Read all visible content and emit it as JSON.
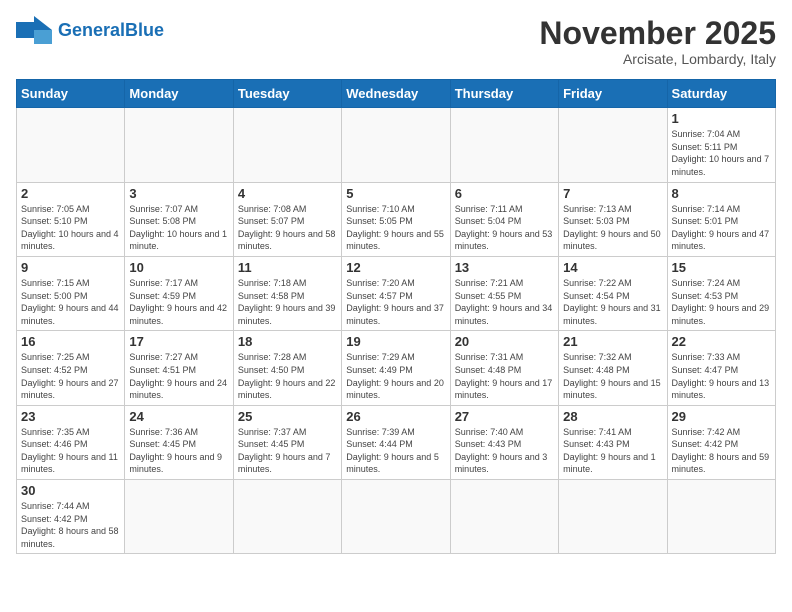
{
  "logo": {
    "text_general": "General",
    "text_blue": "Blue"
  },
  "header": {
    "month": "November 2025",
    "location": "Arcisate, Lombardy, Italy"
  },
  "days_of_week": [
    "Sunday",
    "Monday",
    "Tuesday",
    "Wednesday",
    "Thursday",
    "Friday",
    "Saturday"
  ],
  "weeks": [
    [
      {
        "day": "",
        "info": ""
      },
      {
        "day": "",
        "info": ""
      },
      {
        "day": "",
        "info": ""
      },
      {
        "day": "",
        "info": ""
      },
      {
        "day": "",
        "info": ""
      },
      {
        "day": "",
        "info": ""
      },
      {
        "day": "1",
        "info": "Sunrise: 7:04 AM\nSunset: 5:11 PM\nDaylight: 10 hours and 7 minutes."
      }
    ],
    [
      {
        "day": "2",
        "info": "Sunrise: 7:05 AM\nSunset: 5:10 PM\nDaylight: 10 hours and 4 minutes."
      },
      {
        "day": "3",
        "info": "Sunrise: 7:07 AM\nSunset: 5:08 PM\nDaylight: 10 hours and 1 minute."
      },
      {
        "day": "4",
        "info": "Sunrise: 7:08 AM\nSunset: 5:07 PM\nDaylight: 9 hours and 58 minutes."
      },
      {
        "day": "5",
        "info": "Sunrise: 7:10 AM\nSunset: 5:05 PM\nDaylight: 9 hours and 55 minutes."
      },
      {
        "day": "6",
        "info": "Sunrise: 7:11 AM\nSunset: 5:04 PM\nDaylight: 9 hours and 53 minutes."
      },
      {
        "day": "7",
        "info": "Sunrise: 7:13 AM\nSunset: 5:03 PM\nDaylight: 9 hours and 50 minutes."
      },
      {
        "day": "8",
        "info": "Sunrise: 7:14 AM\nSunset: 5:01 PM\nDaylight: 9 hours and 47 minutes."
      }
    ],
    [
      {
        "day": "9",
        "info": "Sunrise: 7:15 AM\nSunset: 5:00 PM\nDaylight: 9 hours and 44 minutes."
      },
      {
        "day": "10",
        "info": "Sunrise: 7:17 AM\nSunset: 4:59 PM\nDaylight: 9 hours and 42 minutes."
      },
      {
        "day": "11",
        "info": "Sunrise: 7:18 AM\nSunset: 4:58 PM\nDaylight: 9 hours and 39 minutes."
      },
      {
        "day": "12",
        "info": "Sunrise: 7:20 AM\nSunset: 4:57 PM\nDaylight: 9 hours and 37 minutes."
      },
      {
        "day": "13",
        "info": "Sunrise: 7:21 AM\nSunset: 4:55 PM\nDaylight: 9 hours and 34 minutes."
      },
      {
        "day": "14",
        "info": "Sunrise: 7:22 AM\nSunset: 4:54 PM\nDaylight: 9 hours and 31 minutes."
      },
      {
        "day": "15",
        "info": "Sunrise: 7:24 AM\nSunset: 4:53 PM\nDaylight: 9 hours and 29 minutes."
      }
    ],
    [
      {
        "day": "16",
        "info": "Sunrise: 7:25 AM\nSunset: 4:52 PM\nDaylight: 9 hours and 27 minutes."
      },
      {
        "day": "17",
        "info": "Sunrise: 7:27 AM\nSunset: 4:51 PM\nDaylight: 9 hours and 24 minutes."
      },
      {
        "day": "18",
        "info": "Sunrise: 7:28 AM\nSunset: 4:50 PM\nDaylight: 9 hours and 22 minutes."
      },
      {
        "day": "19",
        "info": "Sunrise: 7:29 AM\nSunset: 4:49 PM\nDaylight: 9 hours and 20 minutes."
      },
      {
        "day": "20",
        "info": "Sunrise: 7:31 AM\nSunset: 4:48 PM\nDaylight: 9 hours and 17 minutes."
      },
      {
        "day": "21",
        "info": "Sunrise: 7:32 AM\nSunset: 4:48 PM\nDaylight: 9 hours and 15 minutes."
      },
      {
        "day": "22",
        "info": "Sunrise: 7:33 AM\nSunset: 4:47 PM\nDaylight: 9 hours and 13 minutes."
      }
    ],
    [
      {
        "day": "23",
        "info": "Sunrise: 7:35 AM\nSunset: 4:46 PM\nDaylight: 9 hours and 11 minutes."
      },
      {
        "day": "24",
        "info": "Sunrise: 7:36 AM\nSunset: 4:45 PM\nDaylight: 9 hours and 9 minutes."
      },
      {
        "day": "25",
        "info": "Sunrise: 7:37 AM\nSunset: 4:45 PM\nDaylight: 9 hours and 7 minutes."
      },
      {
        "day": "26",
        "info": "Sunrise: 7:39 AM\nSunset: 4:44 PM\nDaylight: 9 hours and 5 minutes."
      },
      {
        "day": "27",
        "info": "Sunrise: 7:40 AM\nSunset: 4:43 PM\nDaylight: 9 hours and 3 minutes."
      },
      {
        "day": "28",
        "info": "Sunrise: 7:41 AM\nSunset: 4:43 PM\nDaylight: 9 hours and 1 minute."
      },
      {
        "day": "29",
        "info": "Sunrise: 7:42 AM\nSunset: 4:42 PM\nDaylight: 8 hours and 59 minutes."
      }
    ],
    [
      {
        "day": "30",
        "info": "Sunrise: 7:44 AM\nSunset: 4:42 PM\nDaylight: 8 hours and 58 minutes."
      },
      {
        "day": "",
        "info": ""
      },
      {
        "day": "",
        "info": ""
      },
      {
        "day": "",
        "info": ""
      },
      {
        "day": "",
        "info": ""
      },
      {
        "day": "",
        "info": ""
      },
      {
        "day": "",
        "info": ""
      }
    ]
  ]
}
